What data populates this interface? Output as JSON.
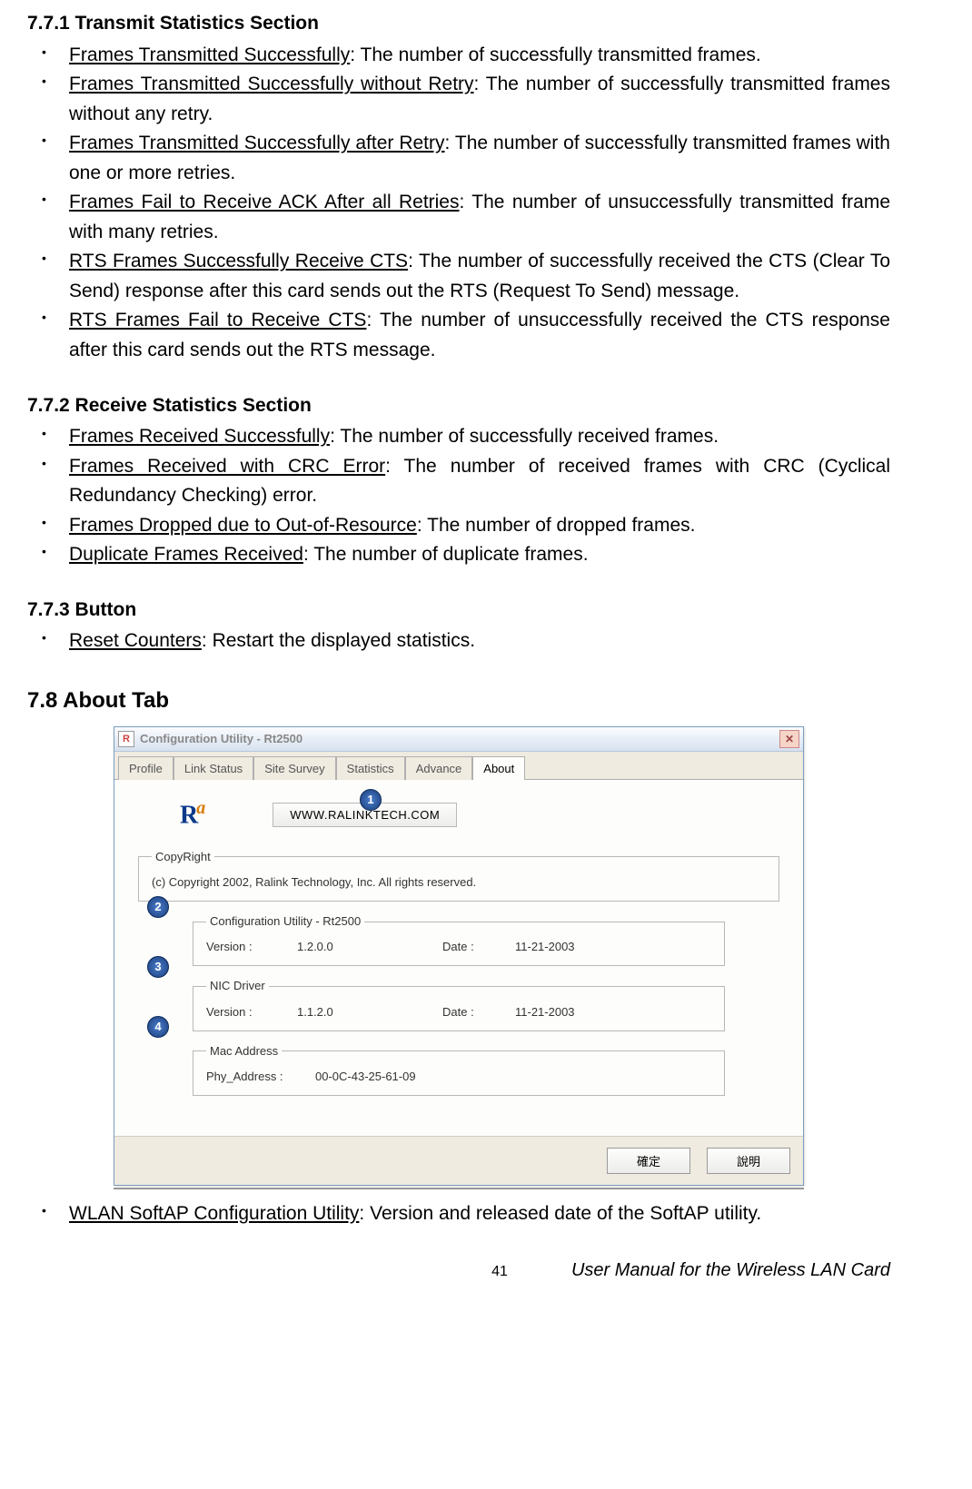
{
  "sections": {
    "s771": {
      "title": "7.7.1 Transmit Statistics Section",
      "items": [
        {
          "term": "Frames Transmitted Successfully",
          "desc": ": The number of successfully transmitted frames."
        },
        {
          "term": "Frames Transmitted Successfully without Retry",
          "desc": ": The number of successfully transmitted frames without any retry."
        },
        {
          "term": "Frames Transmitted Successfully after Retry",
          "desc": ": The number of successfully transmitted frames with one or more retries."
        },
        {
          "term": "Frames Fail to Receive ACK After all Retries",
          "desc": ": The number of unsuccessfully transmitted frame with many retries."
        },
        {
          "term": "RTS Frames Successfully Receive CTS",
          "desc": ": The number of successfully received the CTS (Clear To Send) response after this card sends out the RTS (Request To Send) message."
        },
        {
          "term": "RTS Frames Fail to Receive CTS",
          "desc": ": The number of unsuccessfully received the CTS response after this card sends out the RTS message."
        }
      ]
    },
    "s772": {
      "title": "7.7.2 Receive Statistics Section",
      "items": [
        {
          "term": "Frames Received Successfully",
          "desc": ": The number of successfully received frames."
        },
        {
          "term": "Frames Received with CRC Error",
          "desc": ": The number of received frames with CRC (Cyclical Redundancy Checking) error."
        },
        {
          "term": "Frames Dropped due to Out-of-Resource",
          "desc": ": The number of dropped frames."
        },
        {
          "term": "Duplicate Frames Received",
          "desc": ": The number of duplicate frames."
        }
      ]
    },
    "s773": {
      "title": "7.7.3 Button",
      "items": [
        {
          "term": "Reset Counters",
          "desc": ": Restart the displayed statistics."
        }
      ]
    },
    "s78": {
      "title": "7.8 About Tab",
      "note": {
        "term": "WLAN SoftAP Configuration Utility",
        "desc": ": Version and released date of the SoftAP utility."
      }
    }
  },
  "dialog": {
    "title": "Configuration Utility - Rt2500",
    "logo_main": "R",
    "logo_sub": "a",
    "tabs": [
      "Profile",
      "Link Status",
      "Site Survey",
      "Statistics",
      "Advance",
      "About"
    ],
    "url": "WWW.RALINKTECH.COM",
    "copyright_legend": "CopyRight",
    "copyright_text": "(c) Copyright 2002, Ralink Technology, Inc.   All rights reserved.",
    "group1_legend": "Configuration Utility - Rt2500",
    "group1_ver_label": "Version :",
    "group1_ver": "1.2.0.0",
    "group1_date_label": "Date :",
    "group1_date": "11-21-2003",
    "group2_legend": "NIC Driver",
    "group2_ver_label": "Version :",
    "group2_ver": "1.1.2.0",
    "group2_date_label": "Date :",
    "group2_date": "11-21-2003",
    "group3_legend": "Mac Address",
    "group3_label": "Phy_Address :",
    "group3_val": "00-0C-43-25-61-09",
    "ok_btn": "確定",
    "help_btn": "說明",
    "callouts": {
      "c1": "1",
      "c2": "2",
      "c3": "3",
      "c4": "4"
    }
  },
  "footer": {
    "page": "41",
    "title": "User Manual for the Wireless LAN Card"
  }
}
